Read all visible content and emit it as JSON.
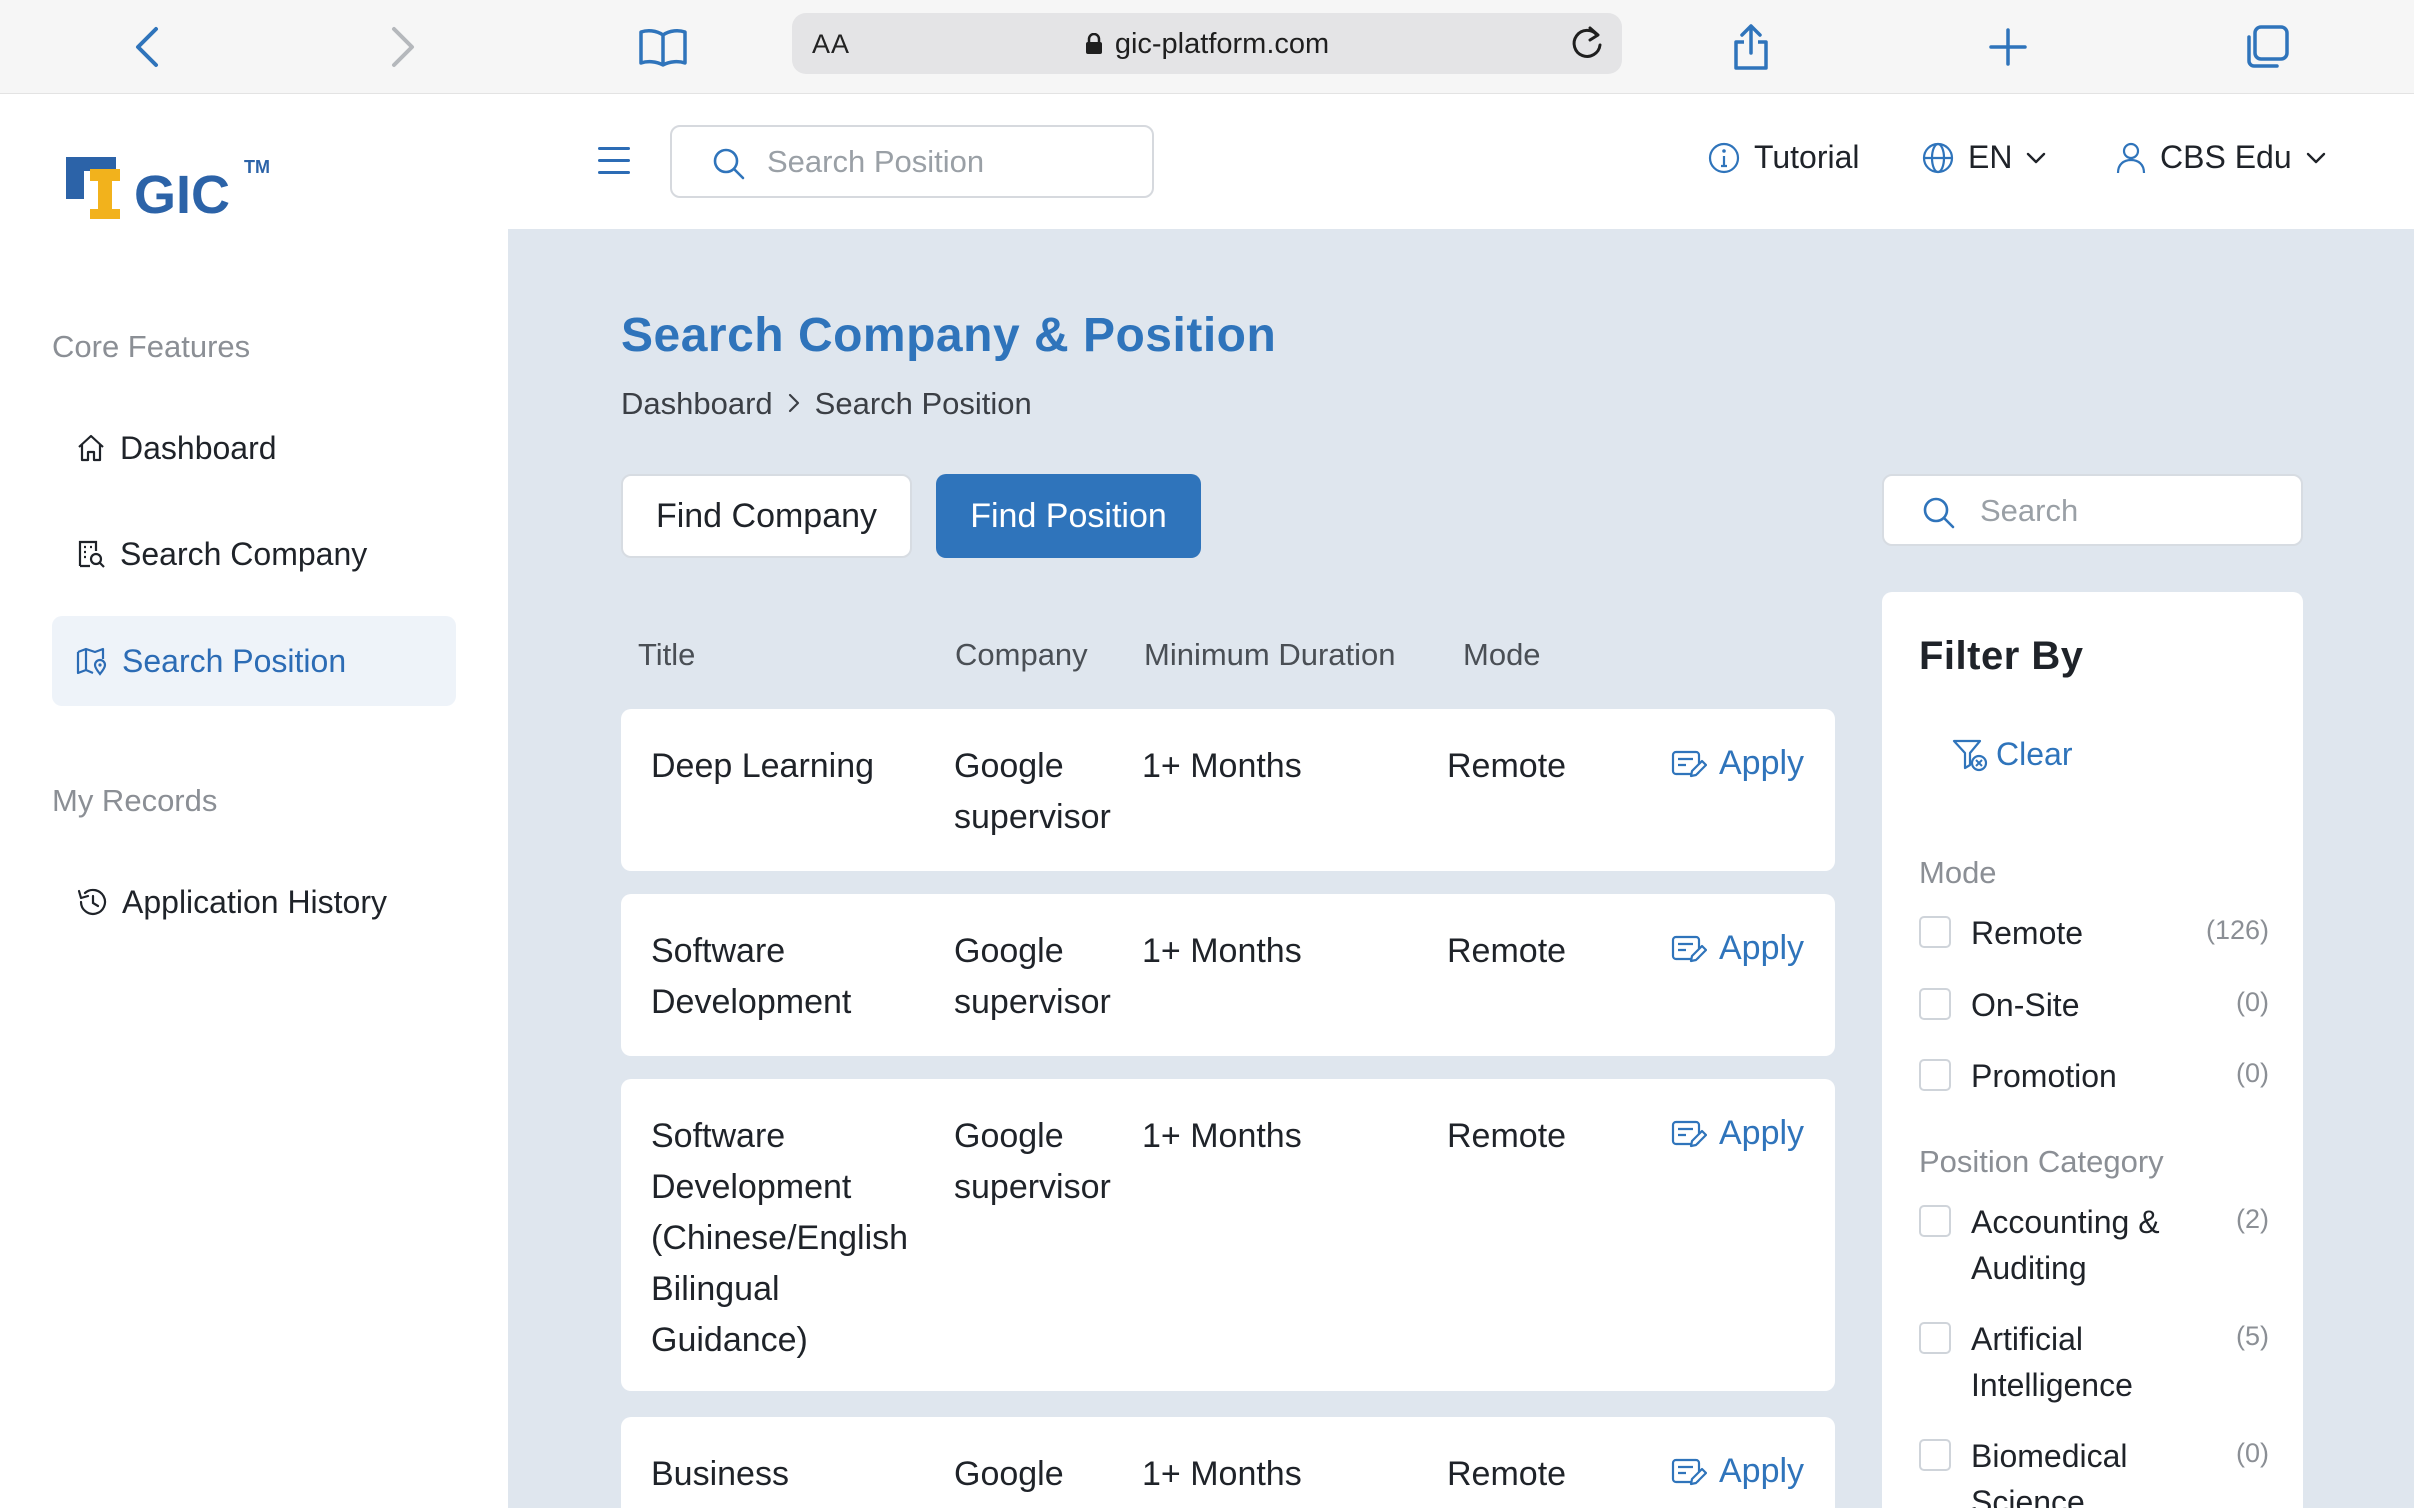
{
  "browser": {
    "url": "gic-platform.com",
    "text_size_label": "AA"
  },
  "sidebar": {
    "logo_text": "GIC",
    "logo_tm": "TM",
    "sections": [
      {
        "label": "Core Features"
      },
      {
        "label": "My Records"
      }
    ],
    "items": [
      {
        "label": "Dashboard",
        "icon": "home-icon"
      },
      {
        "label": "Search Company",
        "icon": "building-search-icon"
      },
      {
        "label": "Search Position",
        "icon": "map-pin-icon",
        "active": true
      },
      {
        "label": "Application History",
        "icon": "history-icon"
      }
    ]
  },
  "header": {
    "search_placeholder": "Search Position",
    "tutorial_label": "Tutorial",
    "language_label": "EN",
    "user_label": "CBS Edu"
  },
  "main": {
    "title": "Search Company & Position",
    "breadcrumb": [
      "Dashboard",
      "Search Position"
    ],
    "tabs": [
      {
        "label": "Find Company",
        "active": false
      },
      {
        "label": "Find Position",
        "active": true
      }
    ],
    "search_placeholder": "Search",
    "columns": [
      "Title",
      "Company",
      "Minimum Duration",
      "Mode"
    ],
    "apply_label": "Apply",
    "rows": [
      {
        "title": "Deep Learning",
        "company": "Google supervisor",
        "duration": "1+ Months",
        "mode": "Remote"
      },
      {
        "title": "Software Development",
        "company": "Google supervisor",
        "duration": "1+ Months",
        "mode": "Remote"
      },
      {
        "title": "Software Development (Chinese/English Bilingual Guidance)",
        "company": "Google supervisor",
        "duration": "1+ Months",
        "mode": "Remote"
      },
      {
        "title": "Business",
        "company": "Google",
        "duration": "1+ Months",
        "mode": "Remote"
      }
    ]
  },
  "filter": {
    "title": "Filter By",
    "clear_label": "Clear",
    "groups": [
      {
        "label": "Mode",
        "options": [
          {
            "name": "Remote",
            "count": "(126)"
          },
          {
            "name": "On-Site",
            "count": "(0)"
          },
          {
            "name": "Promotion",
            "count": "(0)"
          }
        ]
      },
      {
        "label": "Position Category",
        "options": [
          {
            "name": "Accounting & Auditing",
            "count": "(2)"
          },
          {
            "name": "Artificial Intelligence",
            "count": "(5)"
          },
          {
            "name": "Biomedical Science",
            "count": "(0)"
          }
        ]
      }
    ]
  },
  "colors": {
    "accent": "#2f74bb",
    "main_bg": "#dfe6ee",
    "active_nav_bg": "#eef3f9",
    "logo_blue": "#2c63a8",
    "logo_yellow": "#f2b21c"
  }
}
